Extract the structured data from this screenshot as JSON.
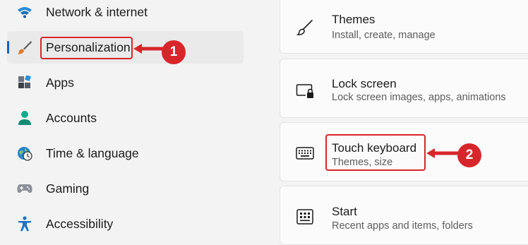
{
  "sidebar": {
    "items": [
      {
        "label": "Network & internet",
        "icon": "wifi-icon"
      },
      {
        "label": "Personalization",
        "icon": "paintbrush-icon",
        "selected": true
      },
      {
        "label": "Apps",
        "icon": "apps-icon"
      },
      {
        "label": "Accounts",
        "icon": "person-icon"
      },
      {
        "label": "Time & language",
        "icon": "globe-clock-icon"
      },
      {
        "label": "Gaming",
        "icon": "gamepad-icon"
      },
      {
        "label": "Accessibility",
        "icon": "accessibility-icon"
      }
    ]
  },
  "cards": [
    {
      "title": "Themes",
      "subtitle": "Install, create, manage",
      "icon": "brush-icon"
    },
    {
      "title": "Lock screen",
      "subtitle": "Lock screen images, apps, animations",
      "icon": "lock-screen-icon"
    },
    {
      "title": "Touch keyboard",
      "subtitle": "Themes, size",
      "icon": "keyboard-icon"
    },
    {
      "title": "Start",
      "subtitle": "Recent apps and items, folders",
      "icon": "start-icon"
    }
  ],
  "annotations": {
    "step1": "1",
    "step2": "2",
    "color": "#d7262b"
  },
  "colors": {
    "accent": "#0067c0"
  }
}
